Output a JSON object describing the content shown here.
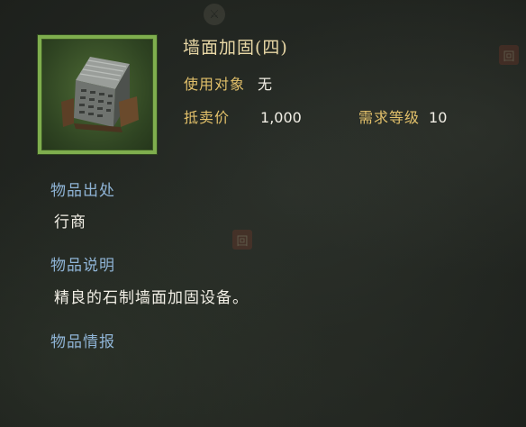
{
  "item": {
    "name": "墙面加固(四)",
    "icon": "stone-wall-reinforcement-icon",
    "frame_color": "#7fae4e",
    "target_label": "使用对象",
    "target_value": "无",
    "price_label": "抵卖价",
    "price_value": "1,000",
    "level_label": "需求等级",
    "level_value": "10"
  },
  "sections": {
    "origin_label": "物品出处",
    "origin_value": "行商",
    "description_label": "物品说明",
    "description_value": "精良的石制墙面加固设备。",
    "info_label": "物品情报"
  },
  "colors": {
    "gold": "#e2c06a",
    "section_blue": "#8fb4d6",
    "value_white": "#f2efe6"
  }
}
